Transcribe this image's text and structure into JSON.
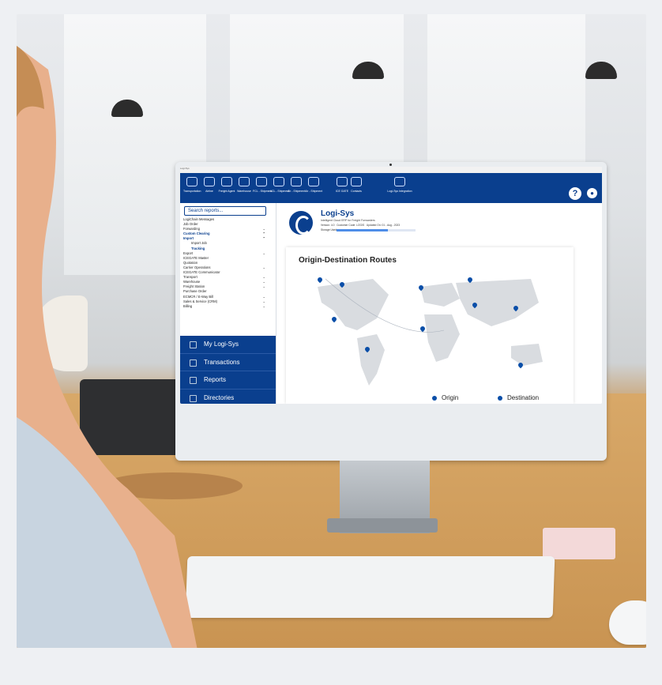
{
  "app": {
    "window_title": "Logi-Sys",
    "ribbon": [
      "Transportation",
      "Airline",
      "Freight Agent",
      "Warehouse",
      "FCL - Shipment",
      "LCL - Shipment",
      "Air - Shipment",
      "Air - Shipment",
      "Contacts"
    ],
    "ribbon_gate": "ICE GATE",
    "ribbon_brand": "Logi-Sys Integration",
    "help_label": "?",
    "user_label": "●"
  },
  "sidebar": {
    "search_placeholder": "Search reports...",
    "items": [
      {
        "label": "LogiChain Messages",
        "style": "normal",
        "chev": ""
      },
      {
        "label": "Job Order",
        "style": "normal",
        "chev": ""
      },
      {
        "label": "Forwarding",
        "style": "normal",
        "chev": "⌄"
      },
      {
        "label": "Custom Clearing",
        "style": "blue",
        "chev": "⌃"
      },
      {
        "label": "Import",
        "style": "blue",
        "chev": "⌃"
      },
      {
        "label": "Import Job",
        "style": "normal",
        "chev": ""
      },
      {
        "label": "Tracking",
        "style": "blue",
        "chev": ""
      },
      {
        "label": "Export",
        "style": "normal",
        "chev": "⌄"
      },
      {
        "label": "ICEGATE Master",
        "style": "normal",
        "chev": ""
      },
      {
        "label": "Quotation",
        "style": "normal",
        "chev": ""
      },
      {
        "label": "Carrier Operations",
        "style": "normal",
        "chev": "⌄"
      },
      {
        "label": "ICEGATE Communicator",
        "style": "normal",
        "chev": ""
      },
      {
        "label": "Transport",
        "style": "normal",
        "chev": "⌄"
      },
      {
        "label": "Warehouse",
        "style": "normal",
        "chev": "⌄"
      },
      {
        "label": "Freight Station",
        "style": "normal",
        "chev": "⌄"
      },
      {
        "label": "Purchase Order",
        "style": "normal",
        "chev": ""
      },
      {
        "label": "ECMCR / E-Way Bill",
        "style": "normal",
        "chev": "⌄"
      },
      {
        "label": "Sales & Service (CRM)",
        "style": "normal",
        "chev": "⌄"
      },
      {
        "label": "Billing",
        "style": "normal",
        "chev": "⌄"
      }
    ],
    "nav": [
      "My Logi-Sys",
      "Transactions",
      "Reports",
      "Directories"
    ]
  },
  "main": {
    "brand": "Logi-Sys",
    "tagline": "Intelligent Cloud ERP for Freight Forwarders",
    "version": "Version: 4.0",
    "customer_code": "Customer Code: LOGIS",
    "updated": "Updated On: 01 - Aug - 2023",
    "storage_label": "Storage Used",
    "storage_used": 0.65,
    "card_title": "Origin-Destination Routes",
    "legend_origin": "Origin",
    "legend_destination": "Destination",
    "colors": {
      "primary": "#0a3f8e",
      "pin": "#0a4ea8",
      "map": "#d9dce0"
    }
  }
}
